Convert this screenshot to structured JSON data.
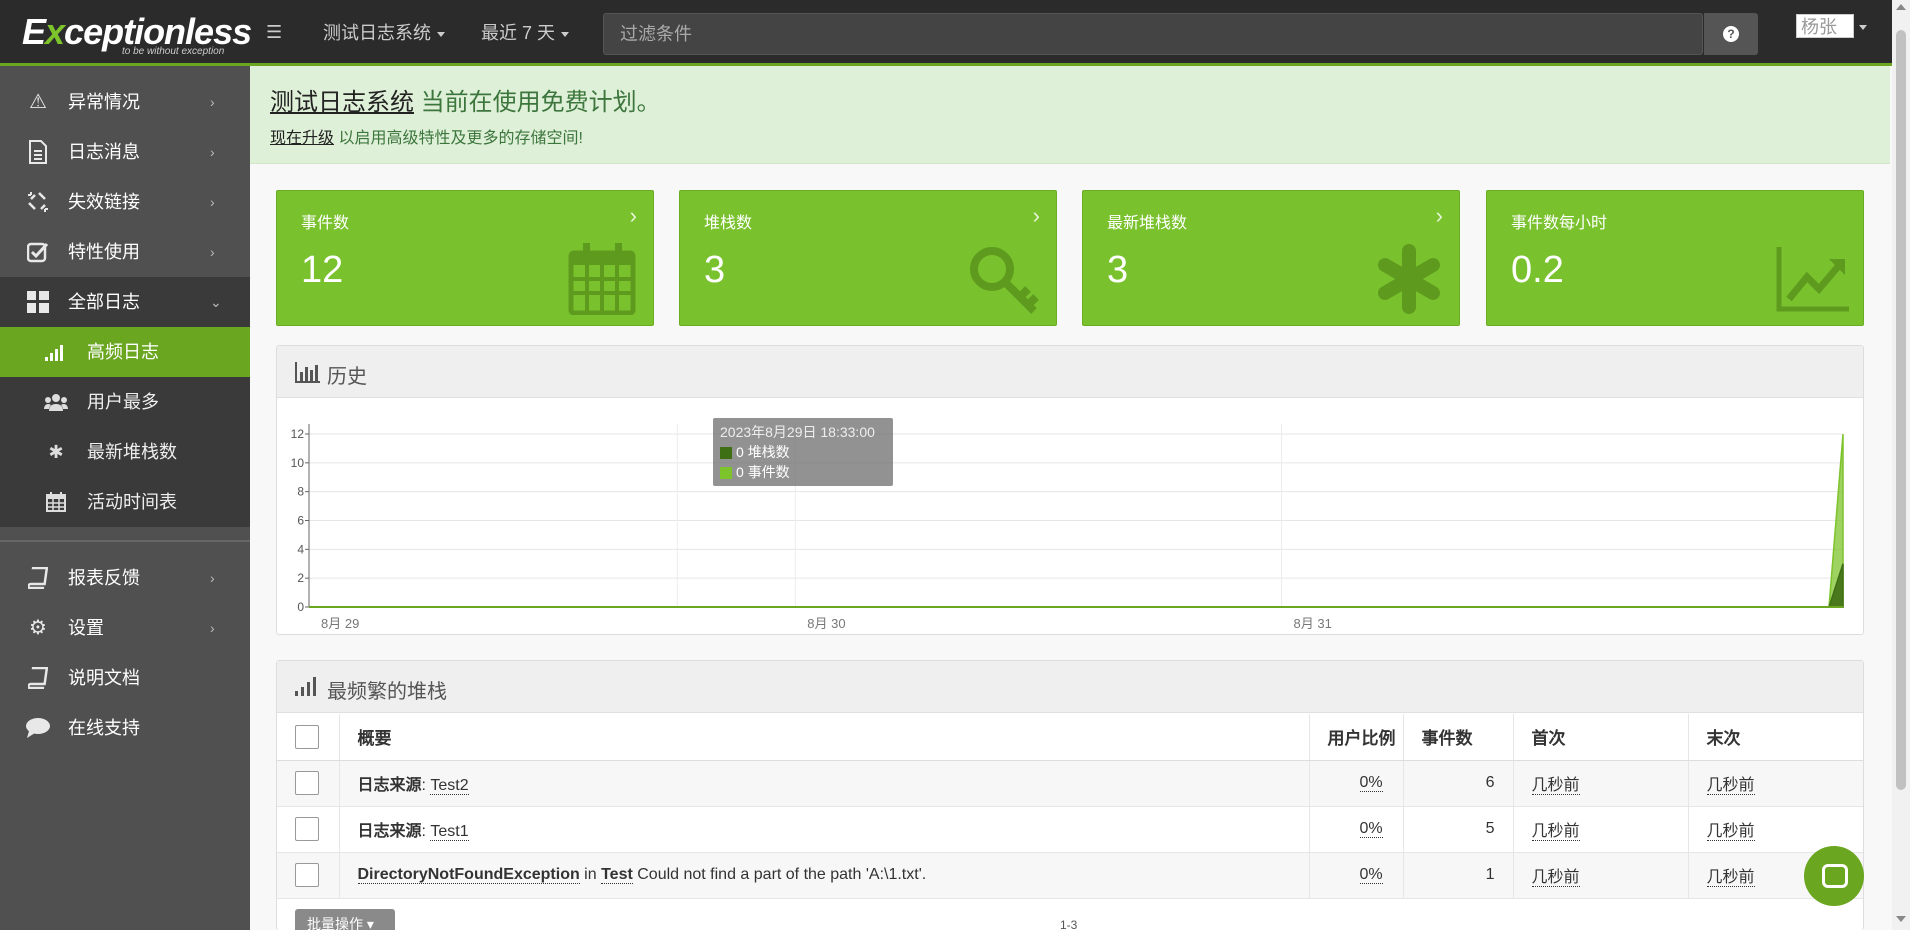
{
  "app": {
    "logo_text_a": "E",
    "logo_text_x": "x",
    "logo_text_b": "ceptionless",
    "logo_tagline": "to be without exception"
  },
  "header": {
    "project_dropdown": "测试日志系统",
    "time_dropdown": "最近 7 天",
    "filter_placeholder": "过滤条件",
    "help_label": "?",
    "user_avatar_alt": "杨张"
  },
  "sidebar": {
    "items": [
      {
        "label": "异常情况",
        "icon": "warning-icon"
      },
      {
        "label": "日志消息",
        "icon": "document-icon"
      },
      {
        "label": "失效链接",
        "icon": "broken-link-icon"
      },
      {
        "label": "特性使用",
        "icon": "checkbox-icon"
      },
      {
        "label": "全部日志",
        "icon": "dashboard-icon"
      }
    ],
    "sub_items": [
      {
        "label": "高频日志",
        "icon": "signal-icon"
      },
      {
        "label": "用户最多",
        "icon": "users-icon"
      },
      {
        "label": "最新堆栈数",
        "icon": "asterisk-icon"
      },
      {
        "label": "活动时间表",
        "icon": "calendar-icon"
      }
    ],
    "bottom_items": [
      {
        "label": "报表反馈",
        "icon": "book-icon"
      },
      {
        "label": "设置",
        "icon": "gear-icon"
      },
      {
        "label": "说明文档",
        "icon": "book-icon"
      },
      {
        "label": "在线支持",
        "icon": "chat-icon"
      }
    ]
  },
  "notice": {
    "project_link": "测试日志系统",
    "plan_text": " 当前在使用免费计划。",
    "upgrade_link": "现在升级",
    "upgrade_text": " 以启用高级特性及更多的存储空间!"
  },
  "stats": [
    {
      "label": "事件数",
      "value": "12",
      "icon": "calendar-icon"
    },
    {
      "label": "堆栈数",
      "value": "3",
      "icon": "key-icon"
    },
    {
      "label": "最新堆栈数",
      "value": "3",
      "icon": "asterisk-icon"
    },
    {
      "label": "事件数每小时",
      "value": "0.2",
      "icon": "trend-icon"
    }
  ],
  "history": {
    "title": "历史",
    "tooltip": {
      "timestamp": "2023年8月29日 18:33:00",
      "rows": [
        {
          "value": "0",
          "label": "堆栈数",
          "color": "#3f6f15"
        },
        {
          "value": "0",
          "label": "事件数",
          "color": "#7dc32c"
        }
      ]
    }
  },
  "chart_data": {
    "type": "area",
    "x": [
      "8月 29",
      "8月 30",
      "8月 31"
    ],
    "xlabel": "",
    "ylabel": "",
    "ylim": [
      0,
      12
    ],
    "yticks": [
      0,
      2,
      4,
      6,
      8,
      10,
      12
    ],
    "series": [
      {
        "name": "堆栈数",
        "color": "#3f6f15",
        "values": [
          0,
          0,
          0,
          3
        ]
      },
      {
        "name": "事件数",
        "color": "#7dc32c",
        "values": [
          0,
          0,
          0,
          12
        ]
      }
    ],
    "grid": true,
    "tick_labels": [
      "8月 29",
      "8月 30",
      "8月 31"
    ]
  },
  "stacks": {
    "title": "最频繁的堆栈",
    "columns": [
      "概要",
      "用户比例",
      "事件数",
      "首次",
      "末次"
    ],
    "rows": [
      {
        "kind": "日志来源",
        "name": "Test2",
        "sep": ": ",
        "users": "0%",
        "events": "6",
        "first": "几秒前",
        "last": "几秒前"
      },
      {
        "kind": "日志来源",
        "name": "Test1",
        "sep": ": ",
        "users": "0%",
        "events": "5",
        "first": "几秒前",
        "last": "几秒前"
      },
      {
        "kind": "DirectoryNotFoundException",
        "in": " in ",
        "name": "Test",
        "msg": " Could not find a part of the path 'A:\\1.txt'.",
        "users": "0%",
        "events": "1",
        "first": "几秒前",
        "last": "几秒前"
      }
    ],
    "bulk_label": "批量操作",
    "pager": "1-3"
  }
}
